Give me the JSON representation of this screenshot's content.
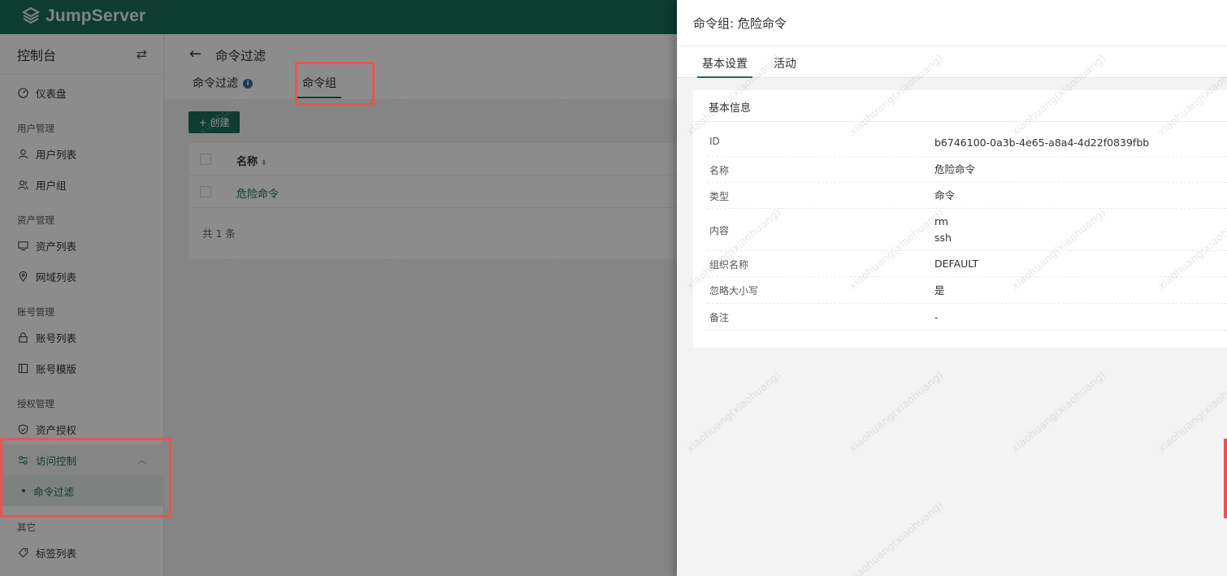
{
  "brand": {
    "name": "JumpServer"
  },
  "sidebar": {
    "title": "控制台",
    "switch_icon": "⇄",
    "items": [
      {
        "label": "仪表盘"
      },
      {
        "group": "用户管理"
      },
      {
        "label": "用户列表"
      },
      {
        "label": "用户组"
      },
      {
        "group": "资产管理"
      },
      {
        "label": "资产列表"
      },
      {
        "label": "网域列表"
      },
      {
        "group": "账号管理"
      },
      {
        "label": "账号列表"
      },
      {
        "label": "账号模版"
      },
      {
        "group": "授权管理"
      },
      {
        "label": "资产授权"
      },
      {
        "label": "访问控制"
      },
      {
        "label": "命令过滤"
      },
      {
        "group": "其它"
      },
      {
        "label": "标签列表"
      }
    ]
  },
  "page": {
    "title": "命令过滤",
    "tabs": [
      {
        "label": "命令过滤"
      },
      {
        "label": "命令组"
      }
    ],
    "create_label": "+ 创建",
    "table": {
      "columns": [
        "名称"
      ],
      "rows": [
        {
          "name": "危险命令"
        }
      ],
      "total": "共 1 条"
    }
  },
  "drawer": {
    "title": "命令组: 危险命令",
    "tabs": [
      {
        "label": "基本设置"
      },
      {
        "label": "活动"
      }
    ],
    "section_title": "基本信息",
    "fields": [
      {
        "key": "ID",
        "value": "b6746100-0a3b-4e65-a8a4-4d22f0839fbb"
      },
      {
        "key": "名称",
        "value": "危险命令"
      },
      {
        "key": "类型",
        "value": "命令"
      },
      {
        "key": "内容",
        "value": "rm",
        "value2": "ssh"
      },
      {
        "key": "组织名称",
        "value": "DEFAULT"
      },
      {
        "key": "忽略大小写",
        "value": "是"
      },
      {
        "key": "备注",
        "value": "-"
      }
    ]
  },
  "watermark": "xiaohuang(xiaohuang)",
  "colors": {
    "brand": "#1b6e59",
    "highlight": "#e85454"
  }
}
